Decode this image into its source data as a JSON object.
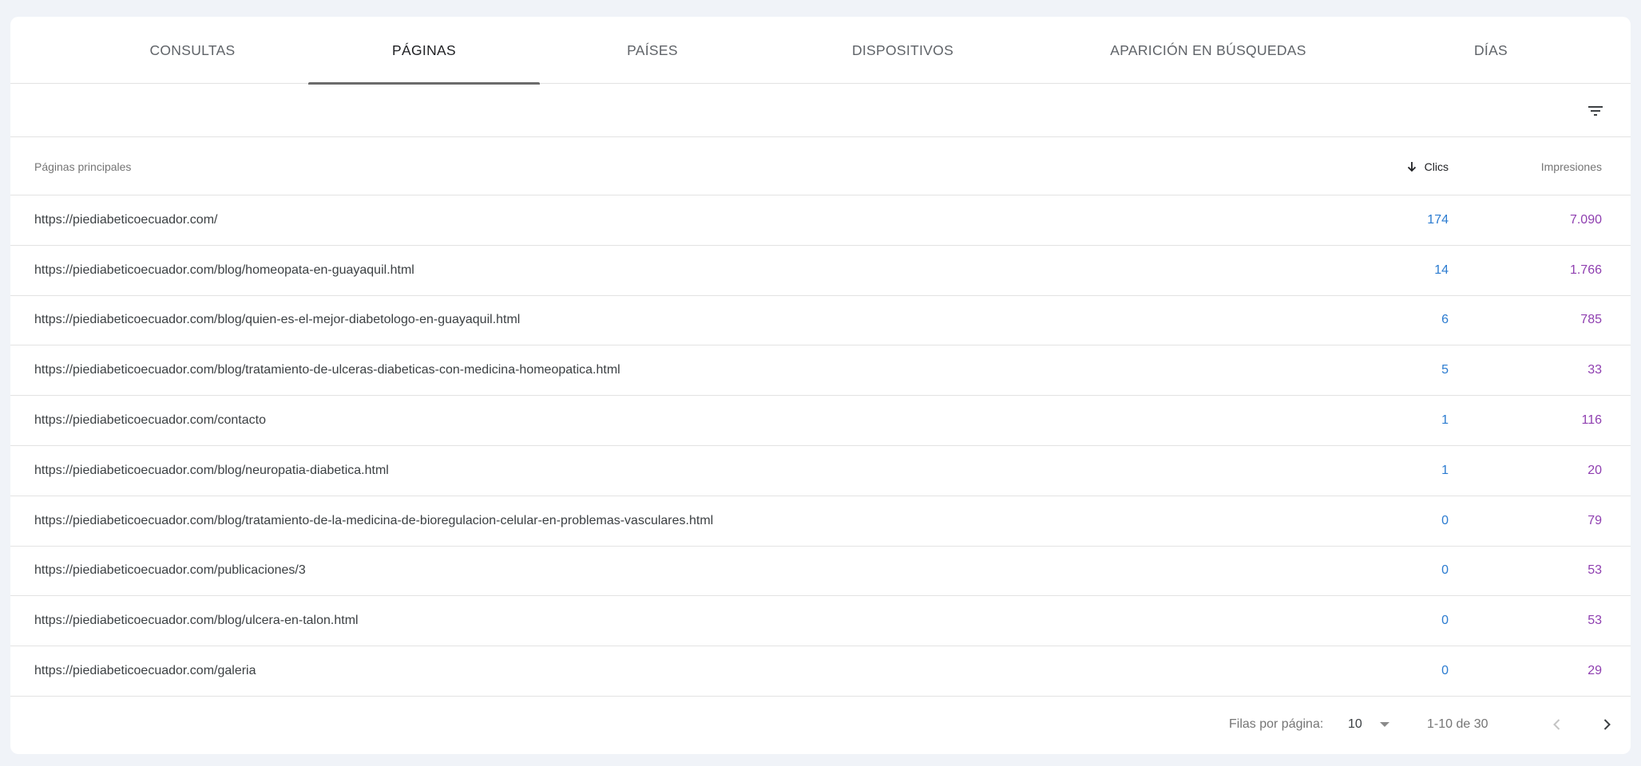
{
  "tabs": [
    {
      "label": "CONSULTAS",
      "active": false
    },
    {
      "label": "PÁGINAS",
      "active": true
    },
    {
      "label": "PAÍSES",
      "active": false
    },
    {
      "label": "DISPOSITIVOS",
      "active": false
    },
    {
      "label": "APARICIÓN EN BÚSQUEDAS",
      "active": false
    },
    {
      "label": "DÍAS",
      "active": false
    }
  ],
  "filter": {
    "icon": "filter-icon"
  },
  "table": {
    "headers": {
      "pages": "Páginas principales",
      "clicks": "Clics",
      "impressions": "Impresiones",
      "sort_icon": "arrow-down-icon"
    },
    "rows": [
      {
        "url": "https://piediabeticoecuador.com/",
        "clicks": "174",
        "impressions": "7.090"
      },
      {
        "url": "https://piediabeticoecuador.com/blog/homeopata-en-guayaquil.html",
        "clicks": "14",
        "impressions": "1.766"
      },
      {
        "url": "https://piediabeticoecuador.com/blog/quien-es-el-mejor-diabetologo-en-guayaquil.html",
        "clicks": "6",
        "impressions": "785"
      },
      {
        "url": "https://piediabeticoecuador.com/blog/tratamiento-de-ulceras-diabeticas-con-medicina-homeopatica.html",
        "clicks": "5",
        "impressions": "33"
      },
      {
        "url": "https://piediabeticoecuador.com/contacto",
        "clicks": "1",
        "impressions": "116"
      },
      {
        "url": "https://piediabeticoecuador.com/blog/neuropatia-diabetica.html",
        "clicks": "1",
        "impressions": "20"
      },
      {
        "url": "https://piediabeticoecuador.com/blog/tratamiento-de-la-medicina-de-bioregulacion-celular-en-problemas-vasculares.html",
        "clicks": "0",
        "impressions": "79"
      },
      {
        "url": "https://piediabeticoecuador.com/publicaciones/3",
        "clicks": "0",
        "impressions": "53"
      },
      {
        "url": "https://piediabeticoecuador.com/blog/ulcera-en-talon.html",
        "clicks": "0",
        "impressions": "53"
      },
      {
        "url": "https://piediabeticoecuador.com/galeria",
        "clicks": "0",
        "impressions": "29"
      }
    ]
  },
  "pagination": {
    "rows_per_page_label": "Filas por página:",
    "rows_per_page_value": "10",
    "range_text": "1-10 de 30",
    "prev_icon": "chevron-left-icon",
    "next_icon": "chevron-right-icon"
  },
  "colors": {
    "clicks": "#2b7bd0",
    "impressions": "#8f3fb0",
    "tab_underline": "#6b6b6b"
  }
}
